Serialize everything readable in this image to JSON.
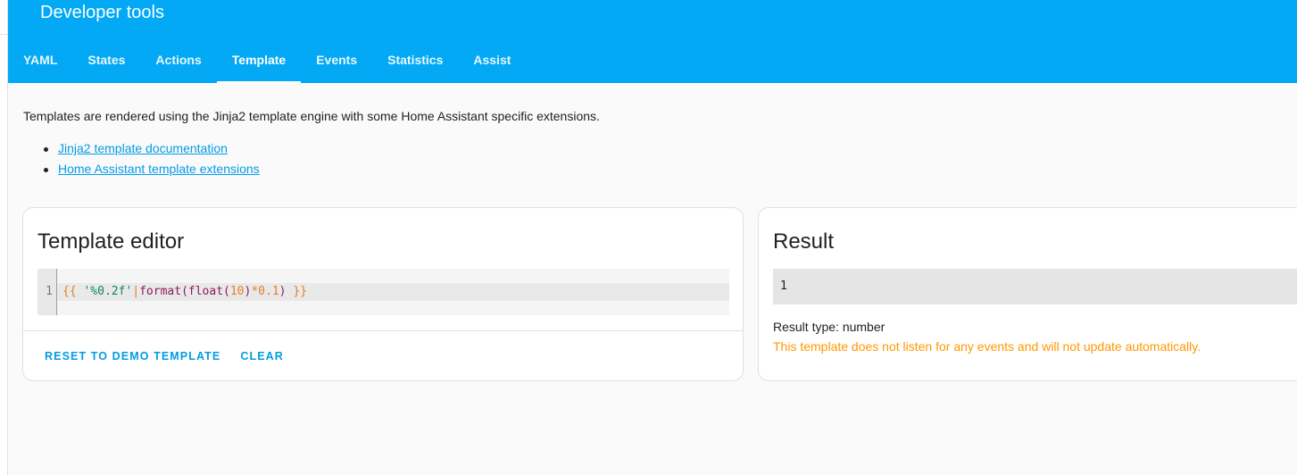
{
  "header": {
    "title": "Developer tools",
    "color": "#03a9f4"
  },
  "tabs": [
    {
      "label": "YAML",
      "active": false
    },
    {
      "label": "States",
      "active": false
    },
    {
      "label": "Actions",
      "active": false
    },
    {
      "label": "Template",
      "active": true
    },
    {
      "label": "Events",
      "active": false
    },
    {
      "label": "Statistics",
      "active": false
    },
    {
      "label": "Assist",
      "active": false
    }
  ],
  "intro": {
    "text": "Templates are rendered using the Jinja2 template engine with some Home Assistant specific extensions.",
    "links": [
      {
        "label": "Jinja2 template documentation"
      },
      {
        "label": "Home Assistant template extensions"
      }
    ]
  },
  "editor": {
    "title": "Template editor",
    "line_number": "1",
    "code": {
      "open": "{{",
      "string": "'%0.2f'",
      "pipe": "|",
      "fn": "format(float(",
      "num1": "10",
      "mid": ")",
      "op": "*",
      "num2": "0.1",
      "end": ")",
      "close": "}}"
    },
    "reset_label": "RESET TO DEMO TEMPLATE",
    "clear_label": "CLEAR"
  },
  "result": {
    "title": "Result",
    "value": "1",
    "type_text": "Result type: number",
    "warning": "This template does not listen for any events and will not update automatically."
  }
}
